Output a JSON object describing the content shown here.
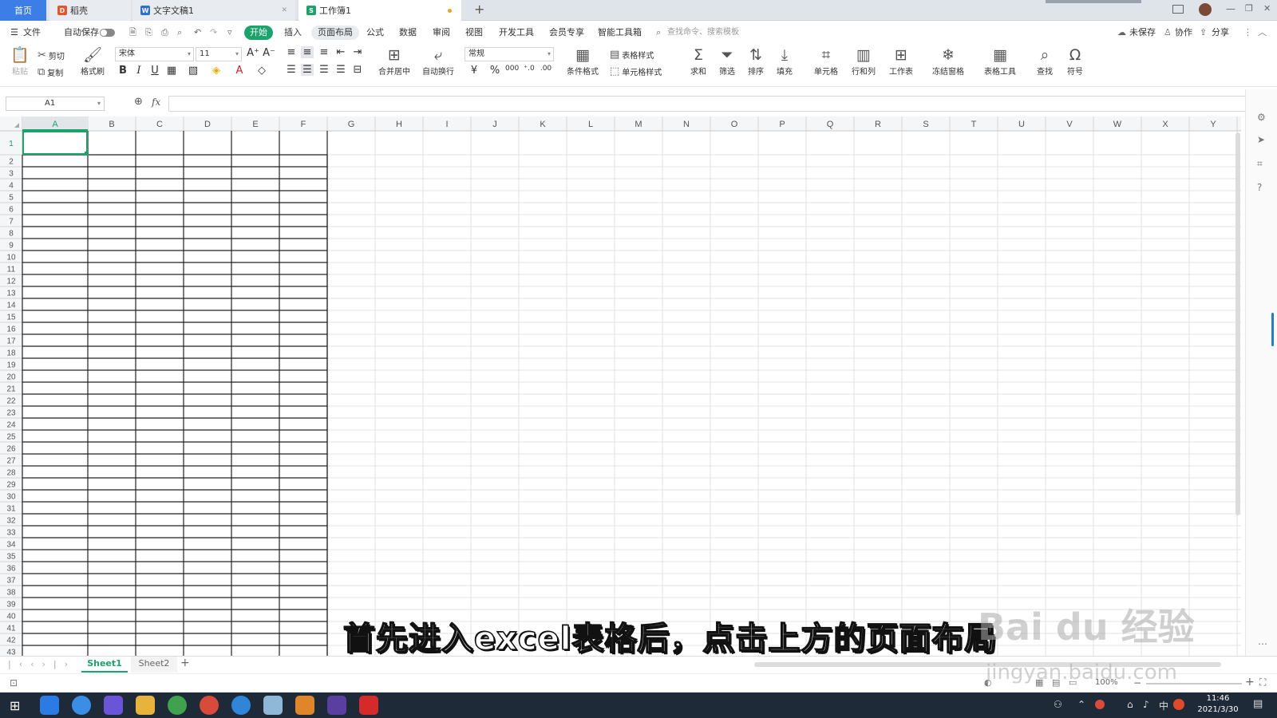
{
  "tabs": [
    {
      "label": "首页"
    },
    {
      "label": "稻壳"
    },
    {
      "label": "文字文稿1"
    },
    {
      "label": "工作簿1"
    }
  ],
  "new_tab_label": "+",
  "menu": {
    "file": "文件",
    "autosave": "自动保存",
    "start": "开始",
    "items": [
      "插入",
      "页面布局",
      "公式",
      "数据",
      "审阅",
      "视图",
      "开发工具",
      "会员专享",
      "智能工具箱"
    ],
    "search_placeholder": "查找命令、搜索模板",
    "unsaved": "未保存",
    "collab": "协作",
    "share": "分享"
  },
  "ribbon": {
    "paste": "粘贴",
    "cut": "剪切",
    "copy": "复制",
    "format_painter": "格式刷",
    "font_name": "宋体",
    "font_size": "11",
    "merge_center": "合并居中",
    "wrap_text": "自动换行",
    "number_format": "常规",
    "table_style": "表格样式",
    "cond_format": "条件格式",
    "cell_style": "单元格样式",
    "sum": "求和",
    "filter": "筛选",
    "sort": "排序",
    "fill": "填充",
    "cell": "单元格",
    "row_col": "行和列",
    "worksheet": "工作表",
    "freeze": "冻结窗格",
    "table_tools": "表格工具",
    "find": "查找",
    "symbol": "符号"
  },
  "formula_bar": {
    "cell_ref": "A1",
    "fx": "fx",
    "value": ""
  },
  "columns": [
    "A",
    "B",
    "C",
    "D",
    "E",
    "F",
    "G",
    "H",
    "I",
    "J",
    "K",
    "L",
    "M",
    "N",
    "O",
    "P",
    "Q",
    "R",
    "S",
    "T",
    "U",
    "V",
    "W",
    "X",
    "Y"
  ],
  "sheets": [
    "Sheet1",
    "Sheet2"
  ],
  "add_sheet": "+",
  "status": {
    "zoom": "100%"
  },
  "subtitle": "首先进入excel表格后，点击上方的页面布局",
  "watermark": {
    "brand": "Bai  du 经验",
    "url": "jingyan.baidu.com"
  },
  "taskbar": {
    "ime": "中",
    "time": "11:46",
    "date": "2021/3/30"
  }
}
